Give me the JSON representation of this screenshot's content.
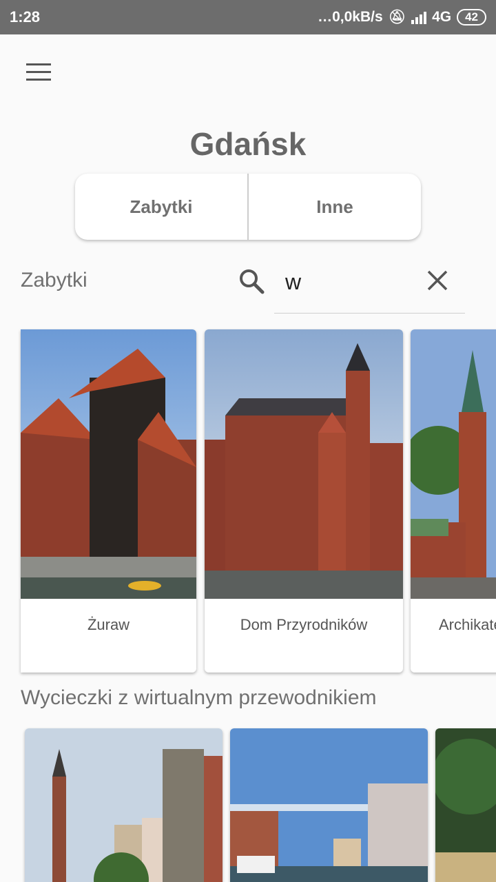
{
  "status_bar": {
    "time": "1:28",
    "network_speed": "…0,0kB/s",
    "network_type": "4G",
    "battery": "42"
  },
  "header": {
    "city": "Gdańsk"
  },
  "tabs": [
    {
      "label": "Zabytki"
    },
    {
      "label": "Inne"
    }
  ],
  "search": {
    "section_label": "Zabytki",
    "value": "w"
  },
  "monuments": [
    {
      "name": "Żuraw"
    },
    {
      "name": "Dom Przyrodników"
    },
    {
      "name": "Archikatedra"
    }
  ],
  "tours": {
    "title": "Wycieczki z wirtualnym przewodnikiem"
  }
}
